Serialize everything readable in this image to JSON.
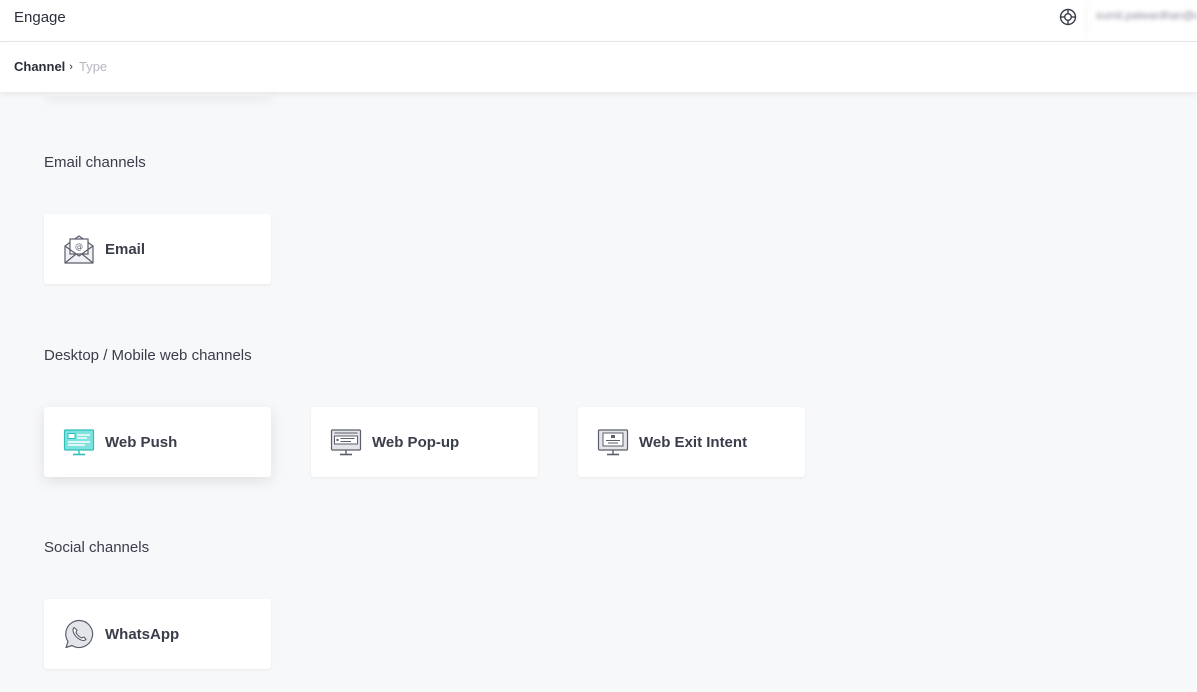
{
  "header": {
    "app_title": "Engage",
    "user_name": "sumit.patwardhan@example"
  },
  "breadcrumb": {
    "channel": "Channel",
    "separator": "›",
    "type": "Type"
  },
  "sections": {
    "email": {
      "title": "Email channels",
      "cards": [
        {
          "label": "Email",
          "icon": "envelope-icon"
        }
      ]
    },
    "web": {
      "title": "Desktop / Mobile web channels",
      "cards": [
        {
          "label": "Web Push",
          "icon": "monitor-push-icon"
        },
        {
          "label": "Web Pop-up",
          "icon": "monitor-popup-icon"
        },
        {
          "label": "Web Exit Intent",
          "icon": "monitor-exit-icon"
        }
      ]
    },
    "social": {
      "title": "Social channels",
      "cards": [
        {
          "label": "WhatsApp",
          "icon": "whatsapp-icon"
        }
      ]
    }
  },
  "colors": {
    "background": "#f7f8fa",
    "card": "#ffffff",
    "accent_teal": "#3fd0c9",
    "text": "#3a3d4a"
  }
}
